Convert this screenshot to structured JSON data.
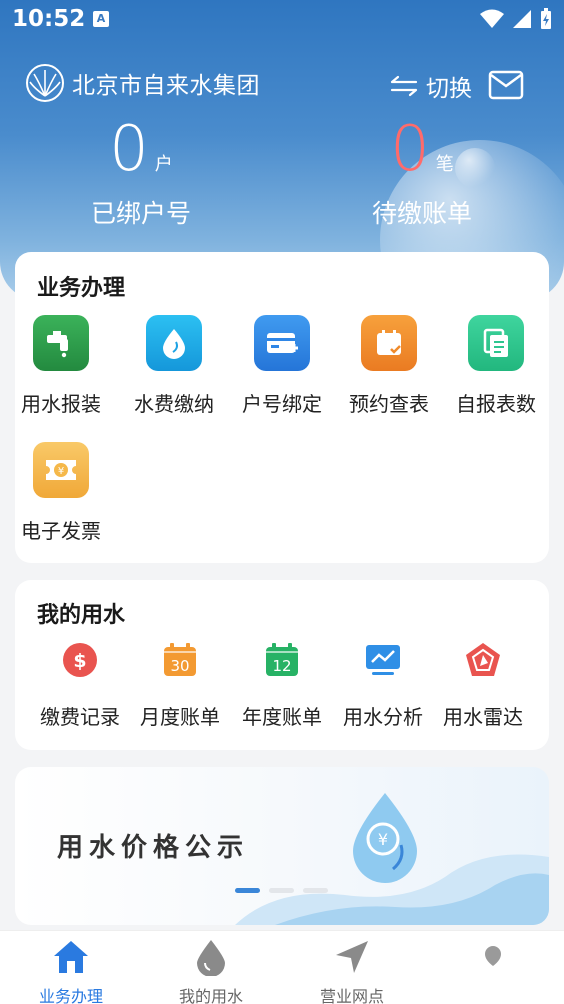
{
  "status_bar": {
    "time": "10:52"
  },
  "header": {
    "org_name": "北京市自来水集团",
    "switch_label": "切换",
    "stats": [
      {
        "value": "0",
        "unit": "户",
        "label": "已绑户号"
      },
      {
        "value": "0",
        "unit": "笔",
        "label": "待缴账单"
      }
    ]
  },
  "services": {
    "title": "业务办理",
    "items": [
      {
        "label": "用水报装",
        "icon": "faucet-icon",
        "color": "#2e9a4a"
      },
      {
        "label": "水费缴纳",
        "icon": "water-drop-icon",
        "color": "#20a8e8"
      },
      {
        "label": "户号绑定",
        "icon": "card-add-icon",
        "color": "#2f86e6"
      },
      {
        "label": "预约查表",
        "icon": "calendar-check-icon",
        "color": "#f08a2a"
      },
      {
        "label": "自报表数",
        "icon": "document-copy-icon",
        "color": "#2ec58f"
      },
      {
        "label": "电子发票",
        "icon": "ticket-yuan-icon",
        "color": "#f5b84a"
      }
    ]
  },
  "my_water": {
    "title": "我的用水",
    "items": [
      {
        "label": "缴费记录",
        "icon": "dollar-circle-icon",
        "color": "#e9544f"
      },
      {
        "label": "月度账单",
        "icon": "calendar-30-icon",
        "color": "#f39a32",
        "day": "30"
      },
      {
        "label": "年度账单",
        "icon": "calendar-12-icon",
        "color": "#27b265",
        "day": "12"
      },
      {
        "label": "用水分析",
        "icon": "monitor-chart-icon",
        "color": "#2f8fe6"
      },
      {
        "label": "用水雷达",
        "icon": "radar-pentagon-icon",
        "color": "#e9544f"
      }
    ]
  },
  "banner": {
    "text": "用水价格公示",
    "slides": 3,
    "active_slide": 1
  },
  "tabbar": {
    "items": [
      {
        "label": "业务办理",
        "icon": "home-icon",
        "active": true
      },
      {
        "label": "我的用水",
        "icon": "drop-icon",
        "active": false
      },
      {
        "label": "营业网点",
        "icon": "navigation-icon",
        "active": false
      },
      {
        "label": "",
        "icon": "location-pin-icon",
        "active": false
      }
    ]
  }
}
